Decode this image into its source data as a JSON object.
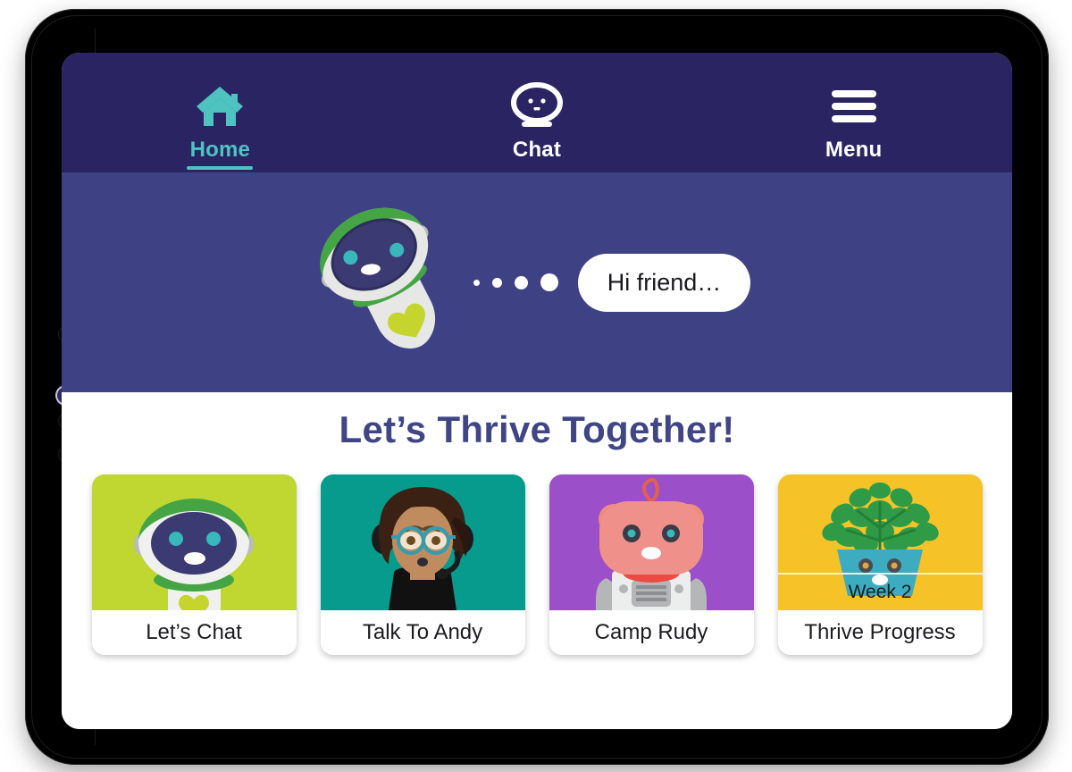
{
  "nav": {
    "items": [
      {
        "label": "Home",
        "icon": "home-icon",
        "active": true
      },
      {
        "label": "Chat",
        "icon": "robot-head-icon",
        "active": false
      },
      {
        "label": "Menu",
        "icon": "hamburger-icon",
        "active": false
      }
    ]
  },
  "hero": {
    "avatar": "robot-mascot",
    "typing_dots": 4,
    "message": "Hi friend…"
  },
  "main": {
    "title": "Let’s Thrive Together!",
    "cards": [
      {
        "label": "Let’s Chat",
        "art": "robot-avatar",
        "bg": "#bfd730"
      },
      {
        "label": "Talk To Andy",
        "art": "counselor-avatar",
        "bg": "#079b8e"
      },
      {
        "label": "Camp Rudy",
        "art": "bear-robot-avatar",
        "bg": "#9b4fc8"
      },
      {
        "label": "Thrive Progress",
        "art": "plant-avatar",
        "bg": "#f5c328",
        "badge": "Week 2"
      }
    ]
  },
  "colors": {
    "header_navy": "#2a2463",
    "hero_navy": "#3e4284",
    "teal_accent": "#4ec3c0",
    "title_navy": "#3f4585",
    "bubble_white": "#ffffff"
  }
}
